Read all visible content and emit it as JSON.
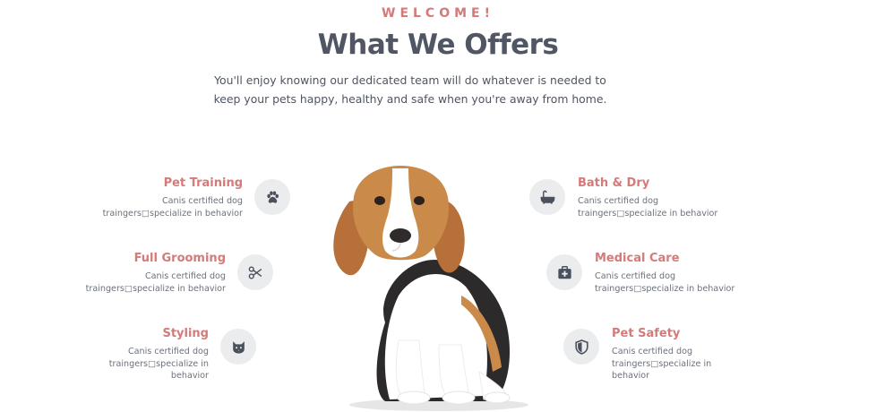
{
  "header": {
    "eyebrow": "WELCOME!",
    "title": "What We Offers",
    "subtitle": "You'll enjoy knowing our dedicated team will do whatever is needed to keep your pets happy, healthy and safe when you're away from home."
  },
  "services": {
    "left": [
      {
        "title": "Pet Training",
        "desc_line1": "Canis certified dog",
        "desc_line2": "traingers□specialize in behavior",
        "desc_line3": "",
        "icon": "paw-icon"
      },
      {
        "title": "Full Grooming",
        "desc_line1": "Canis certified dog",
        "desc_line2": "traingers□specialize in behavior",
        "desc_line3": "",
        "icon": "scissors-icon"
      },
      {
        "title": "Styling",
        "desc_line1": "Canis certified dog",
        "desc_line2": "traingers□specialize in",
        "desc_line3": "behavior",
        "icon": "cat-face-icon"
      }
    ],
    "right": [
      {
        "title": "Bath & Dry",
        "desc_line1": "Canis certified dog",
        "desc_line2": "traingers□specialize in behavior",
        "desc_line3": "",
        "icon": "bathtub-icon"
      },
      {
        "title": "Medical Care",
        "desc_line1": "Canis certified dog",
        "desc_line2": "traingers□specialize in behavior",
        "desc_line3": "",
        "icon": "medical-kit-icon"
      },
      {
        "title": "Pet Safety",
        "desc_line1": "Canis certified dog",
        "desc_line2": "traingers□specialize in",
        "desc_line3": "behavior",
        "icon": "shield-icon"
      }
    ]
  },
  "colors": {
    "accent": "#d47a78",
    "heading": "#505663",
    "text": "#6c717a",
    "icon_bg": "#ebecee",
    "icon_fg": "#4a505c"
  }
}
